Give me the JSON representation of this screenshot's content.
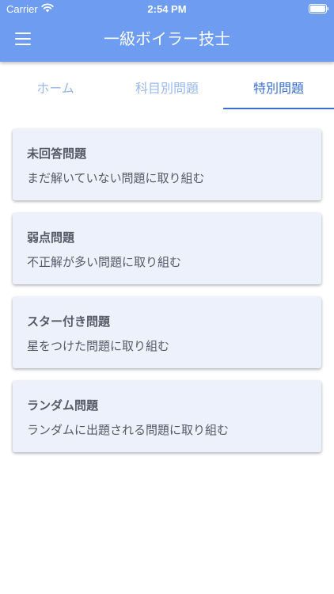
{
  "status_bar": {
    "carrier": "Carrier",
    "time": "2:54 PM",
    "icons": [
      "wifi-icon",
      "battery-icon"
    ]
  },
  "header": {
    "title": "一級ボイラー技士",
    "menu_icon": "hamburger-icon",
    "background_color": "#6d9cf0"
  },
  "tabs": [
    {
      "label": "ホーム",
      "active": false
    },
    {
      "label": "科目別問題",
      "active": false
    },
    {
      "label": "特別問題",
      "active": true
    }
  ],
  "colors": {
    "accent": "#3b6fd2",
    "tab_inactive": "#9ab8ec",
    "card_background": "#edf1fc"
  },
  "cards": [
    {
      "title": "未回答問題",
      "description": "まだ解いていない問題に取り組む"
    },
    {
      "title": "弱点問題",
      "description": "不正解が多い問題に取り組む"
    },
    {
      "title": "スター付き問題",
      "description": "星をつけた問題に取り組む"
    },
    {
      "title": "ランダム問題",
      "description": "ランダムに出題される問題に取り組む"
    }
  ]
}
